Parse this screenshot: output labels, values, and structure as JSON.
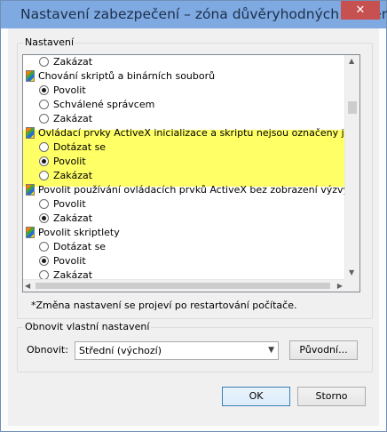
{
  "window": {
    "title": "Nastavení zabezpečení – zóna důvěryhodných serverů",
    "close_symbol": "✕"
  },
  "settings_group": {
    "label": "Nastavení"
  },
  "settings_list": [
    {
      "kind": "option",
      "label": "Zakázat",
      "checked": false
    },
    {
      "kind": "header",
      "label": "Chování skriptů a binárních souborů"
    },
    {
      "kind": "option",
      "label": "Povolit",
      "checked": true
    },
    {
      "kind": "option",
      "label": "Schválené správcem",
      "checked": false
    },
    {
      "kind": "option",
      "label": "Zakázat",
      "checked": false
    },
    {
      "kind": "header",
      "label": "Ovládací prvky ActiveX inicializace a skriptu nejsou označeny jako bez"
    },
    {
      "kind": "option",
      "label": "Dotázat se",
      "checked": false
    },
    {
      "kind": "option",
      "label": "Povolit",
      "checked": true
    },
    {
      "kind": "option",
      "label": "Zakázat",
      "checked": false
    },
    {
      "kind": "header",
      "label": "Povolit používání ovládacích prvků ActiveX bez zobrazení výzvy pouze"
    },
    {
      "kind": "option",
      "label": "Povolit",
      "checked": false
    },
    {
      "kind": "option",
      "label": "Zakázat",
      "checked": true
    },
    {
      "kind": "header",
      "label": "Povolit skriptlety"
    },
    {
      "kind": "option",
      "label": "Dotázat se",
      "checked": false
    },
    {
      "kind": "option",
      "label": "Povolit",
      "checked": true
    },
    {
      "kind": "option",
      "label": "Zakázat",
      "checked": false
    }
  ],
  "restart_note": "*Změna nastavení se projeví po restartování počítače.",
  "reset_group": {
    "label": "Obnovit vlastní nastavení",
    "reset_to_label": "Obnovit:",
    "reset_value": "Střední (výchozí)",
    "reset_button": "Původní..."
  },
  "buttons": {
    "ok": "OK",
    "cancel": "Storno"
  },
  "colors": {
    "highlight": "#ffff66",
    "titlebar": "#7ea9e1",
    "close": "#c75050"
  }
}
